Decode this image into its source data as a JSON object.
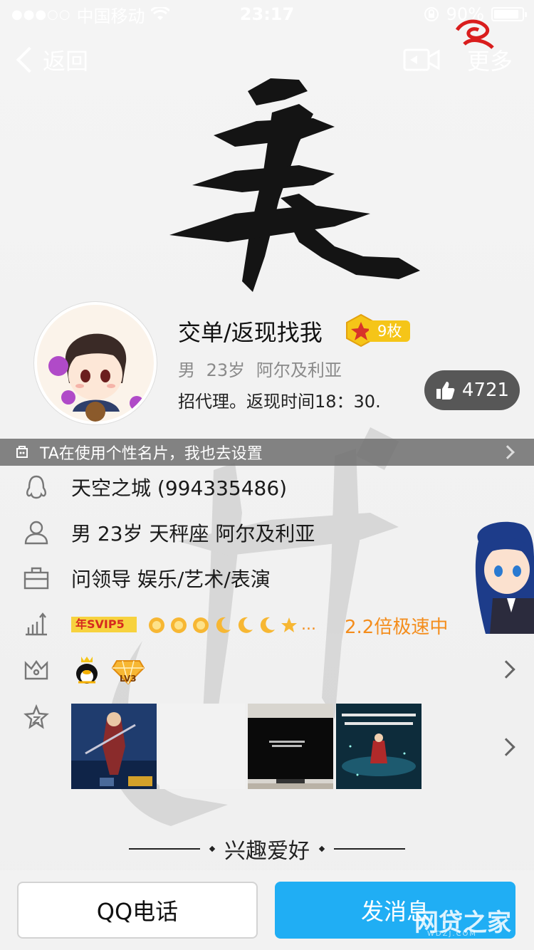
{
  "status": {
    "carrier": "中国移动",
    "time": "23:17",
    "battery": "90%",
    "battery_level": 0.9
  },
  "nav": {
    "back_label": "返回",
    "more_label": "更多"
  },
  "profile": {
    "name": "交单/返现找我",
    "medal_count": "9枚",
    "gender": "男",
    "age": "23岁",
    "location": "阿尔及利亚",
    "bio": "招代理。返现时间18：30.",
    "likes": "4721"
  },
  "card_bar": {
    "text": "TA在使用个性名片，我也去设置"
  },
  "info": {
    "qq": "天空之城 (994335486)",
    "personal": "男 23岁 天秤座 阿尔及利亚",
    "job": "问领导 娱乐/艺术/表演",
    "svip_badge": "年SVIP5",
    "more_dots": "...",
    "speed": "2.2倍极速中",
    "lv_badge": "LV3"
  },
  "hobby": {
    "title": "兴趣爱好"
  },
  "buttons": {
    "call": "QQ电话",
    "message": "发消息"
  },
  "watermark": {
    "main": "网贷之家",
    "sub": "WDZJ.COM"
  },
  "colors": {
    "accent": "#20aef4",
    "speed": "#f48d1c",
    "svip": "#f7d23e"
  }
}
